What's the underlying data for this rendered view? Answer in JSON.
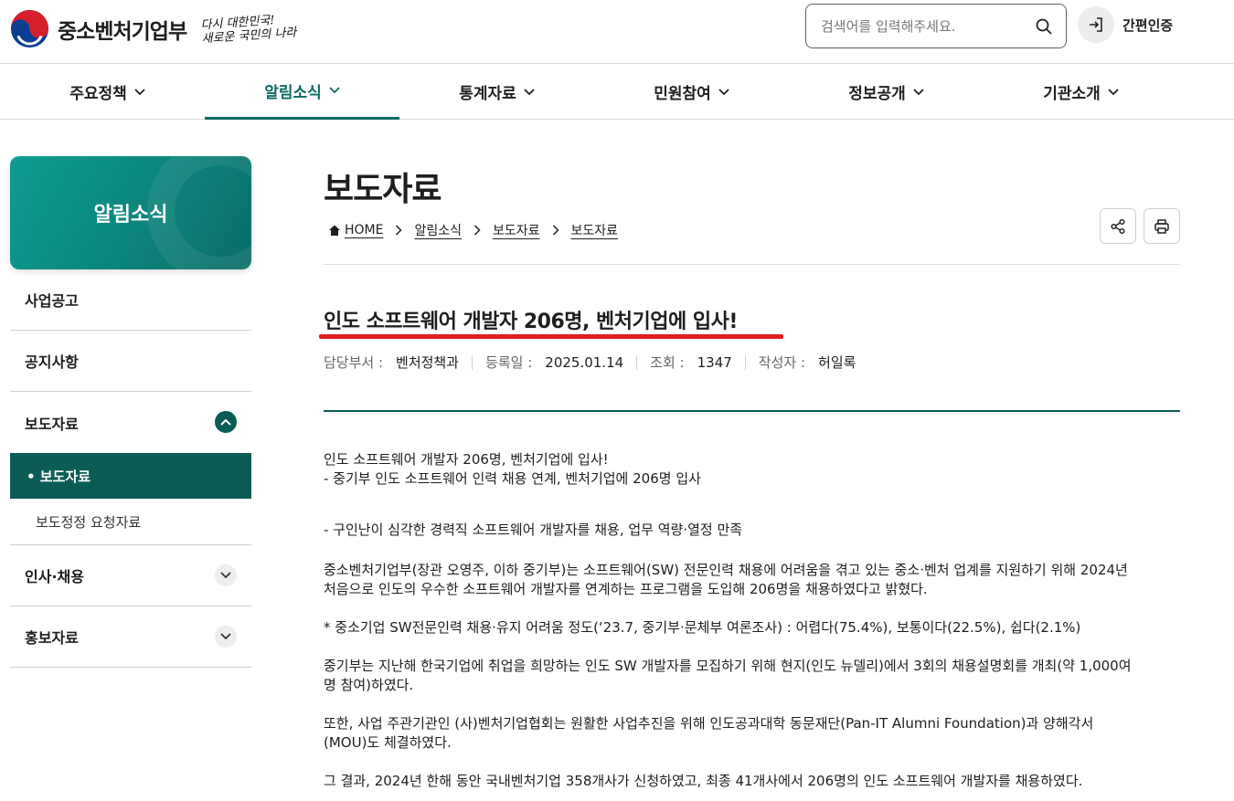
{
  "header": {
    "logo_text": "중소벤처기업부",
    "slogan_line1": "다시 대한민국!",
    "slogan_line2": "새로운 국민의 나라",
    "search_placeholder": "검색어를 입력해주세요.",
    "login_label": "간편인증"
  },
  "gnb": [
    {
      "label": "주요정책"
    },
    {
      "label": "알림소식"
    },
    {
      "label": "통계자료"
    },
    {
      "label": "민원참여"
    },
    {
      "label": "정보공개"
    },
    {
      "label": "기관소개"
    }
  ],
  "sidebar": {
    "title": "알림소식",
    "items": [
      {
        "label": "사업공고"
      },
      {
        "label": "공지사항"
      },
      {
        "label": "보도자료"
      },
      {
        "label": "인사·채용"
      },
      {
        "label": "홍보자료"
      }
    ],
    "sub_items": [
      {
        "label": "• 보도자료"
      },
      {
        "label": "보도정정 요청자료"
      }
    ]
  },
  "page": {
    "title": "보도자료",
    "breadcrumb": [
      "HOME",
      "알림소식",
      "보도자료",
      "보도자료"
    ]
  },
  "article": {
    "title": "인도 소프트웨어 개발자 206명, 벤처기업에 입사!",
    "meta": {
      "dept_label": "담당부서 :",
      "dept": "벤처정책과",
      "date_label": "등록일 :",
      "date": "2025.01.14",
      "views_label": "조회 :",
      "views": "1347",
      "author_label": "작성자 :",
      "author": "허일록"
    },
    "paragraphs": [
      "인도 소프트웨어 개발자 206명, 벤처기업에 입사!\n- 중기부 인도 소프트웨어 인력 채용 연계, 벤처기업에 206명 입사",
      "- 구인난이 심각한 경력직 소프트웨어 개발자를 채용, 업무 역량·열정 만족",
      "중소벤처기업부(장관 오영주, 이하 중기부)는 소프트웨어(SW) 전문인력 채용에 어려움을 겪고 있는 중소·벤처 업계를 지원하기 위해 2024년\n처음으로 인도의 우수한 소프트웨어 개발자를 연계하는 프로그램을 도입해 206명을 채용하였다고 밝혔다.",
      "* 중소기업 SW전문인력 채용·유지 어려움 정도(‘23.7, 중기부·문체부 여론조사) : 어렵다(75.4%), 보통이다(22.5%), 쉽다(2.1%)",
      "중기부는 지난해 한국기업에 취업을 희망하는 인도 SW 개발자를 모집하기 위해 현지(인도 뉴델리)에서 3회의 채용설명회를 개최(약 1,000여\n명 참여)하였다.",
      "또한, 사업 주관기관인 (사)벤처기업협회는 원활한 사업추진을 위해 인도공과대학 동문재단(Pan-IT Alumni Foundation)과 양해각서\n(MOU)도 체결하였다.",
      "그 결과, 2024년 한해 동안 국내벤처기업 358개사가 신청하였고, 최종 41개사에서 206명의 인도 소프트웨어 개발자를 채용하였다."
    ]
  },
  "colors": {
    "accent": "#0b6b63",
    "sidebar_active": "#0b5c57",
    "title_underline": "#e11c1c"
  }
}
